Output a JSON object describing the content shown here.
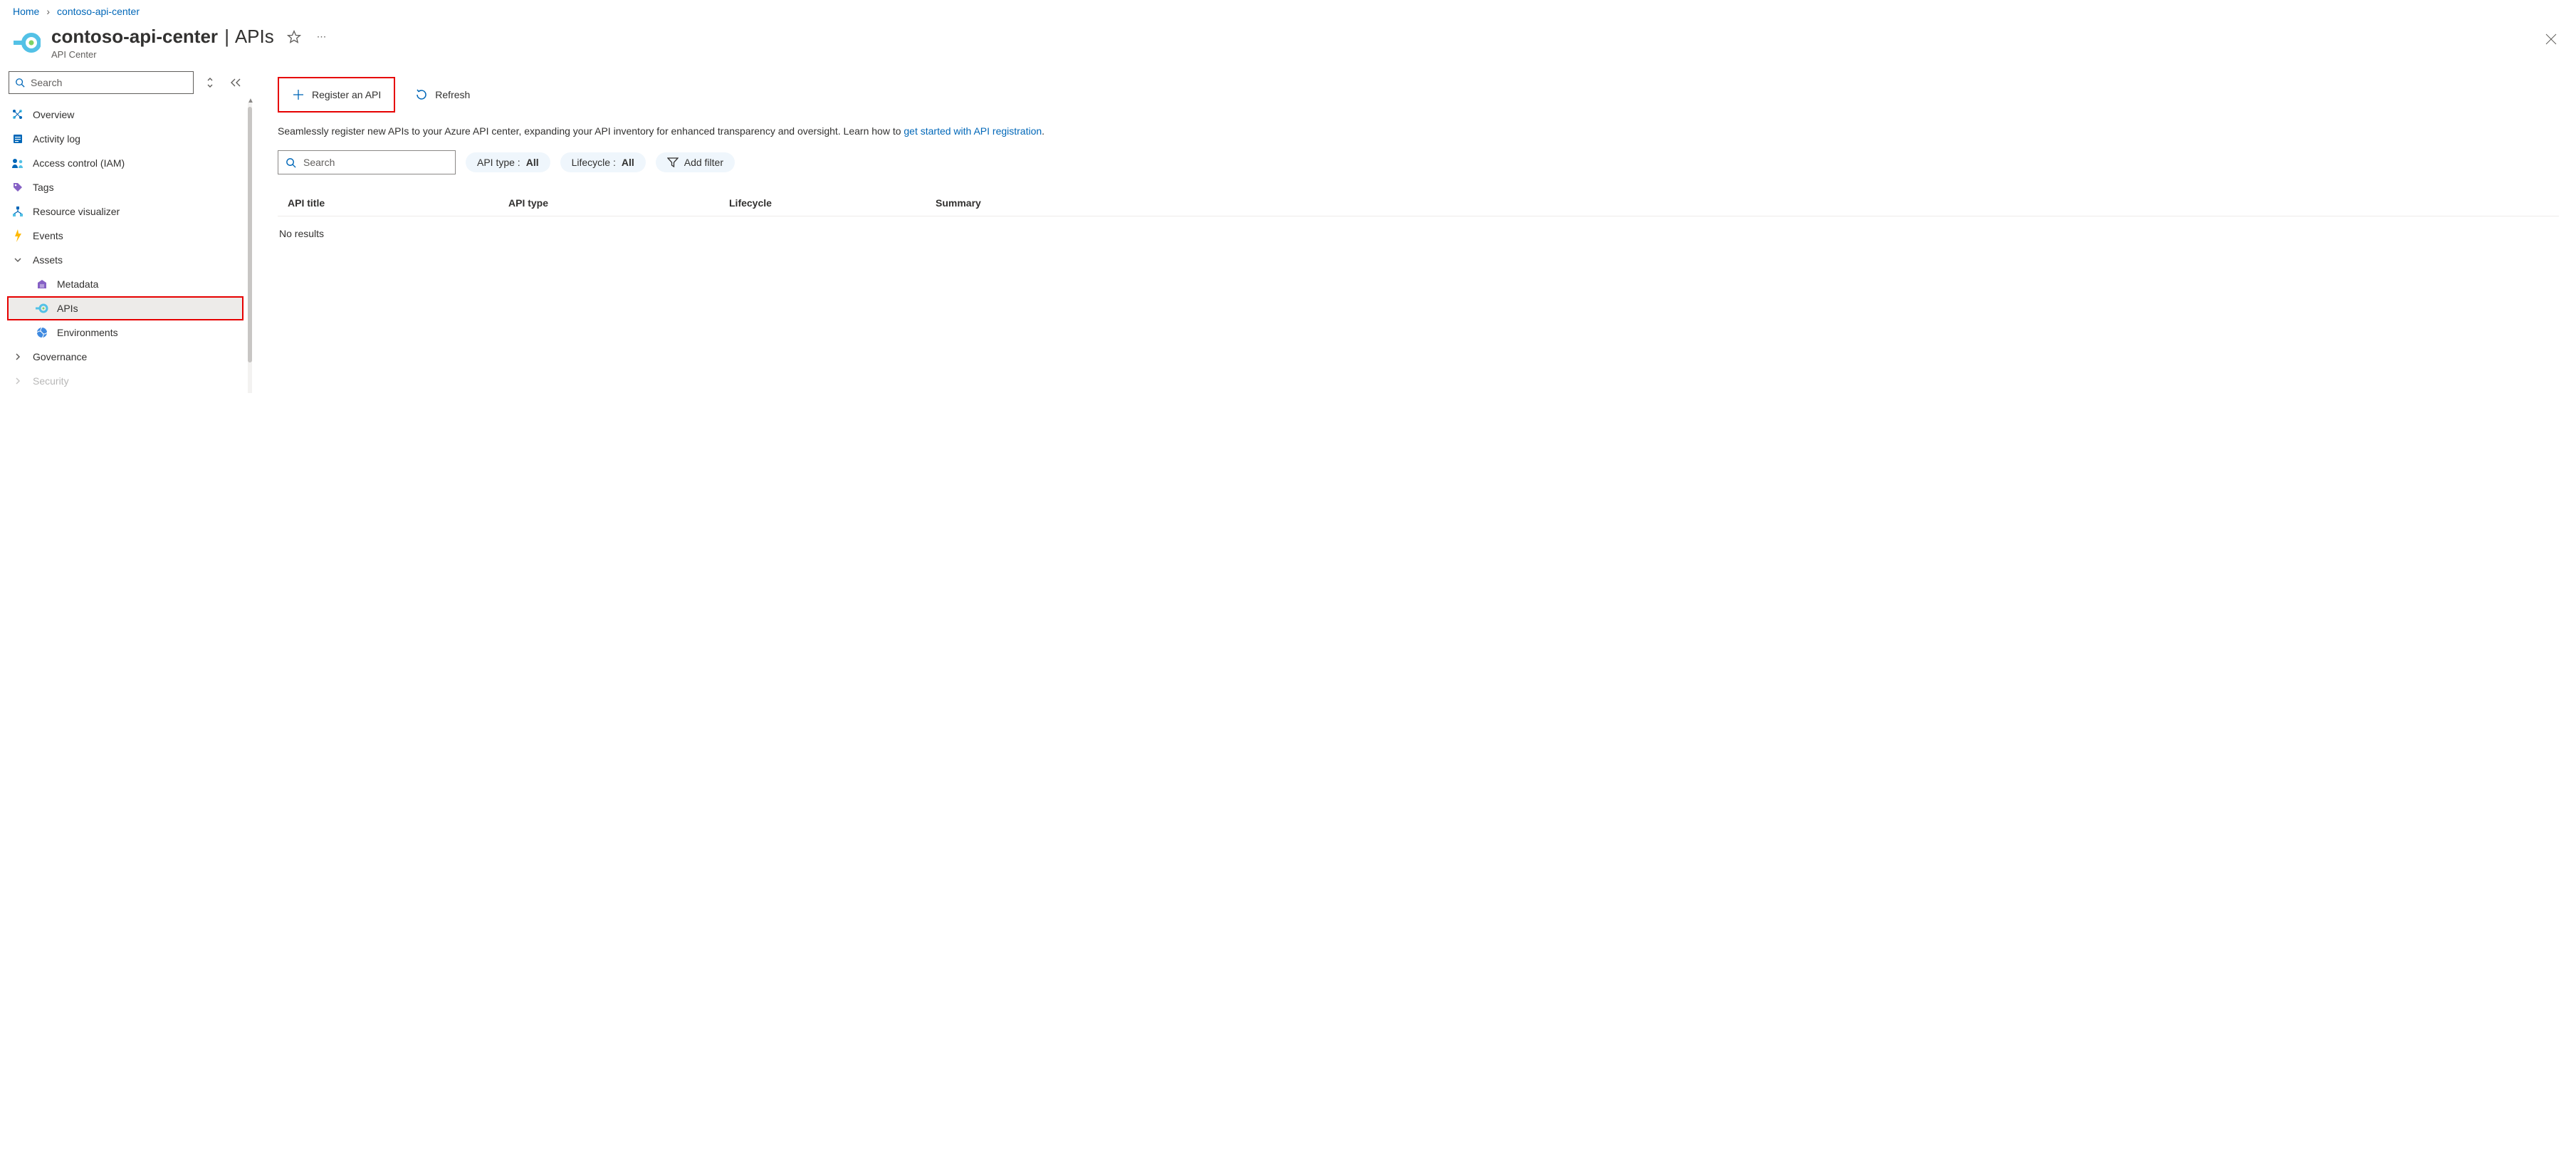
{
  "breadcrumb": {
    "home": "Home",
    "resource": "contoso-api-center"
  },
  "header": {
    "resource_name": "contoso-api-center",
    "section": "APIs",
    "subtitle": "API Center"
  },
  "sidebar": {
    "search_placeholder": "Search",
    "items": {
      "overview": "Overview",
      "activity_log": "Activity log",
      "access_control": "Access control (IAM)",
      "tags": "Tags",
      "resource_visualizer": "Resource visualizer",
      "events": "Events"
    },
    "groups": {
      "assets": {
        "label": "Assets",
        "metadata": "Metadata",
        "apis": "APIs",
        "environments": "Environments"
      },
      "governance": {
        "label": "Governance"
      },
      "security": {
        "label": "Security"
      }
    }
  },
  "toolbar": {
    "register": "Register an API",
    "refresh": "Refresh"
  },
  "intro": {
    "text": "Seamlessly register new APIs to your Azure API center, expanding your API inventory for enhanced transparency and oversight. Learn how to ",
    "link": "get started with API registration",
    "suffix": "."
  },
  "filters": {
    "search_placeholder": "Search",
    "api_type_label": "API type : ",
    "api_type_value": "All",
    "lifecycle_label": "Lifecycle : ",
    "lifecycle_value": "All",
    "add_filter": "Add filter"
  },
  "table": {
    "columns": {
      "title": "API title",
      "type": "API type",
      "lifecycle": "Lifecycle",
      "summary": "Summary"
    },
    "no_results": "No results"
  }
}
